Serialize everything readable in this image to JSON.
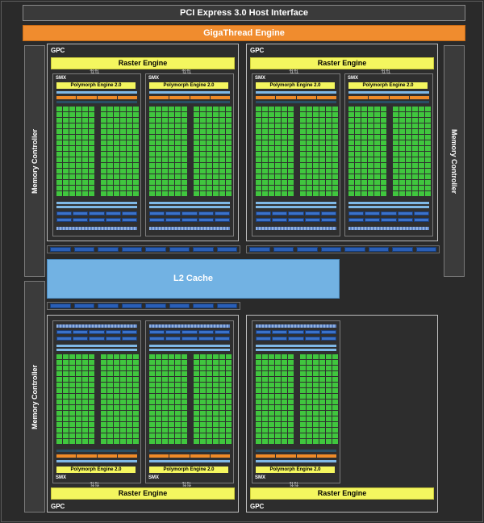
{
  "header": {
    "pcie": "PCI Express 3.0 Host Interface",
    "giga": "GigaThread Engine"
  },
  "memory_controller": "Memory Controller",
  "l2": "L2 Cache",
  "gpc_label": "GPC",
  "raster_label": "Raster Engine",
  "smx_label": "SMX",
  "poly_label": "Polymorph Engine 2.0",
  "colors": {
    "core": "#40c63e",
    "poly": "#f4f65f",
    "giga": "#f08c2e",
    "l2": "#72b2e3",
    "ldst": "#3b72c9"
  }
}
